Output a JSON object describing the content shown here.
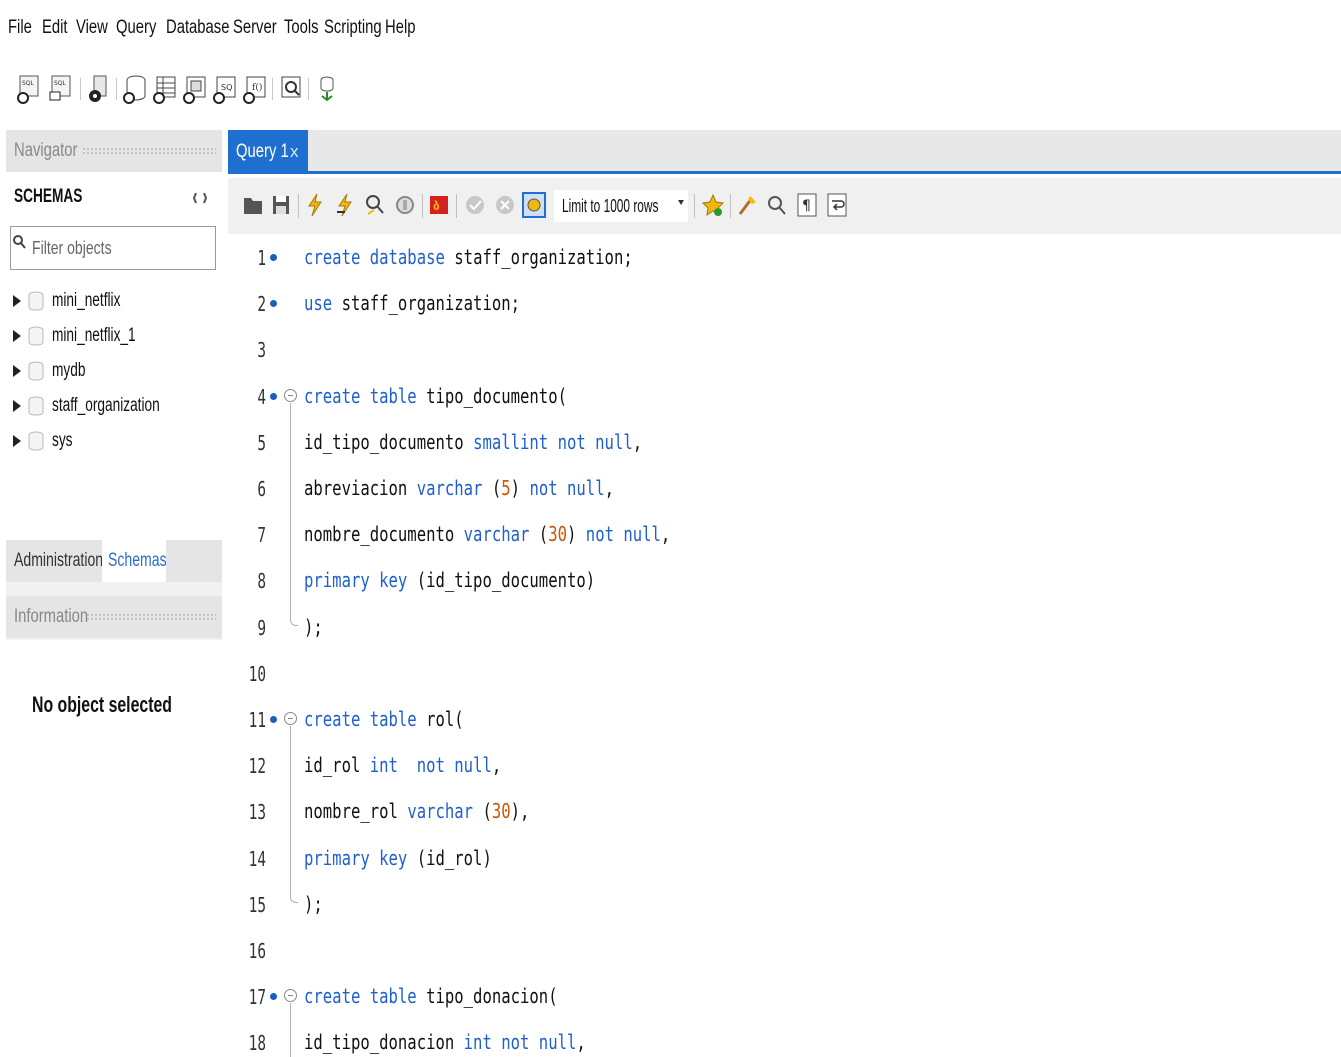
{
  "menu": [
    "File",
    "Edit",
    "View",
    "Query",
    "Database",
    "Server",
    "Tools",
    "Scripting",
    "Help"
  ],
  "navigator": {
    "header": "Navigator",
    "schemas_title": "SCHEMAS",
    "filter_placeholder": "Filter objects",
    "schemas": [
      "mini_netflix",
      "mini_netflix_1",
      "mydb",
      "staff_organization",
      "sys"
    ],
    "tabs": [
      "Administration",
      "Schemas"
    ],
    "active_tab": "Schemas",
    "information_header": "Information",
    "information_text": "No object selected"
  },
  "query_tab": {
    "label": "Query 1",
    "close": "x"
  },
  "sql_toolbar": {
    "limit_label": "Limit to 1000 rows"
  },
  "editor": {
    "lines": [
      {
        "n": "1",
        "dot": true,
        "fold": "",
        "tokens": [
          {
            "t": "create database",
            "k": "kw"
          },
          {
            "t": " staff_organization;",
            "k": ""
          }
        ]
      },
      {
        "n": "2",
        "dot": true,
        "fold": "",
        "tokens": [
          {
            "t": "use",
            "k": "kw"
          },
          {
            "t": " staff_organization;",
            "k": ""
          }
        ]
      },
      {
        "n": "3",
        "dot": false,
        "fold": "",
        "tokens": []
      },
      {
        "n": "4",
        "dot": true,
        "fold": "start",
        "tokens": [
          {
            "t": "create table",
            "k": "kw"
          },
          {
            "t": " tipo_documento(",
            "k": ""
          }
        ]
      },
      {
        "n": "5",
        "dot": false,
        "fold": "mid",
        "tokens": [
          {
            "t": "id_tipo_documento ",
            "k": ""
          },
          {
            "t": "smallint not null",
            "k": "kw"
          },
          {
            "t": ",",
            "k": ""
          }
        ]
      },
      {
        "n": "6",
        "dot": false,
        "fold": "mid",
        "tokens": [
          {
            "t": "abreviacion ",
            "k": ""
          },
          {
            "t": "varchar",
            "k": "kw"
          },
          {
            "t": " (",
            "k": ""
          },
          {
            "t": "5",
            "k": "num"
          },
          {
            "t": ") ",
            "k": ""
          },
          {
            "t": "not null",
            "k": "kw"
          },
          {
            "t": ",",
            "k": ""
          }
        ]
      },
      {
        "n": "7",
        "dot": false,
        "fold": "mid",
        "tokens": [
          {
            "t": "nombre_documento ",
            "k": ""
          },
          {
            "t": "varchar",
            "k": "kw"
          },
          {
            "t": " (",
            "k": ""
          },
          {
            "t": "30",
            "k": "num"
          },
          {
            "t": ") ",
            "k": ""
          },
          {
            "t": "not null",
            "k": "kw"
          },
          {
            "t": ",",
            "k": ""
          }
        ]
      },
      {
        "n": "8",
        "dot": false,
        "fold": "mid",
        "tokens": [
          {
            "t": "primary key",
            "k": "kw"
          },
          {
            "t": " (id_tipo_documento)",
            "k": ""
          }
        ]
      },
      {
        "n": "9",
        "dot": false,
        "fold": "end",
        "tokens": [
          {
            "t": ");",
            "k": ""
          }
        ]
      },
      {
        "n": "10",
        "dot": false,
        "fold": "",
        "tokens": []
      },
      {
        "n": "11",
        "dot": true,
        "fold": "start",
        "tokens": [
          {
            "t": "create table",
            "k": "kw"
          },
          {
            "t": " rol(",
            "k": ""
          }
        ]
      },
      {
        "n": "12",
        "dot": false,
        "fold": "mid",
        "tokens": [
          {
            "t": "id_rol ",
            "k": ""
          },
          {
            "t": "int  not null",
            "k": "kw"
          },
          {
            "t": ",",
            "k": ""
          }
        ]
      },
      {
        "n": "13",
        "dot": false,
        "fold": "mid",
        "tokens": [
          {
            "t": "nombre_rol ",
            "k": ""
          },
          {
            "t": "varchar",
            "k": "kw"
          },
          {
            "t": " (",
            "k": ""
          },
          {
            "t": "30",
            "k": "num"
          },
          {
            "t": "),",
            "k": ""
          }
        ]
      },
      {
        "n": "14",
        "dot": false,
        "fold": "mid",
        "tokens": [
          {
            "t": "primary key",
            "k": "kw"
          },
          {
            "t": " (id_rol)",
            "k": ""
          }
        ]
      },
      {
        "n": "15",
        "dot": false,
        "fold": "end",
        "tokens": [
          {
            "t": ");",
            "k": ""
          }
        ]
      },
      {
        "n": "16",
        "dot": false,
        "fold": "",
        "tokens": []
      },
      {
        "n": "17",
        "dot": true,
        "fold": "start",
        "tokens": [
          {
            "t": "create table",
            "k": "kw"
          },
          {
            "t": " tipo_donacion(",
            "k": ""
          }
        ]
      },
      {
        "n": "18",
        "dot": false,
        "fold": "mid",
        "tokens": [
          {
            "t": "id_tipo_donacion ",
            "k": ""
          },
          {
            "t": "int not null",
            "k": "kw"
          },
          {
            "t": ",",
            "k": ""
          }
        ]
      }
    ]
  },
  "colors": {
    "accent": "#1f6fd1",
    "keyword": "#1f5fcf",
    "number": "#c8570b"
  }
}
